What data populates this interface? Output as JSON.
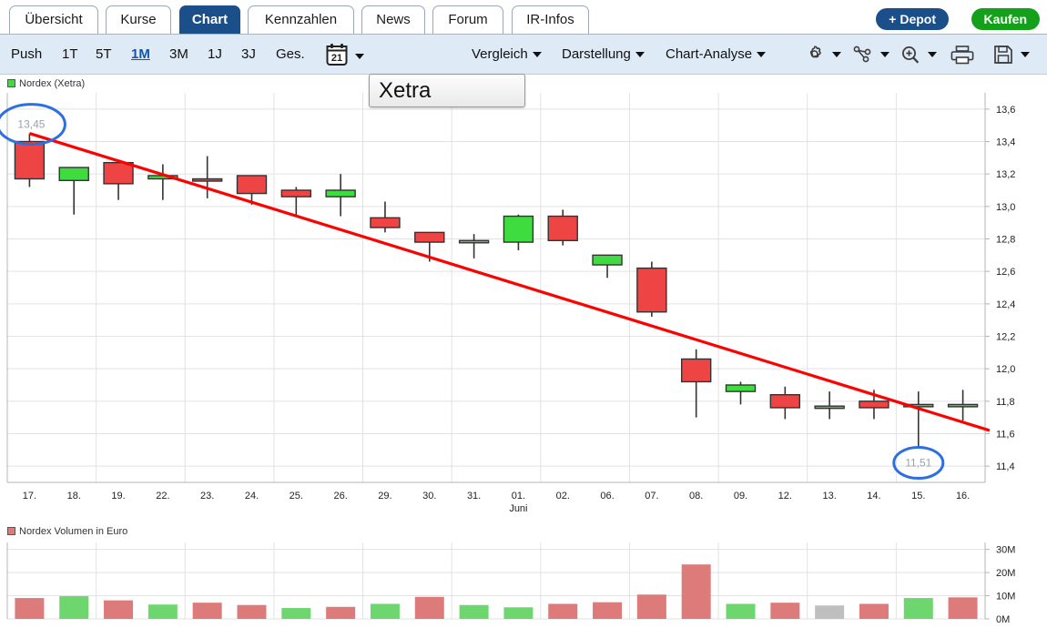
{
  "tabs": [
    {
      "label": "Übersicht",
      "active": false
    },
    {
      "label": "Kurse",
      "active": false
    },
    {
      "label": "Chart",
      "active": true
    },
    {
      "label": "Kennzahlen",
      "active": false
    },
    {
      "label": "News",
      "active": false
    },
    {
      "label": "Forum",
      "active": false
    },
    {
      "label": "IR-Infos",
      "active": false
    }
  ],
  "actions": {
    "depot": "+ Depot",
    "buy": "Kaufen"
  },
  "toolbar": {
    "ranges": [
      {
        "label": "Push",
        "selected": false
      },
      {
        "label": "1T",
        "selected": false
      },
      {
        "label": "5T",
        "selected": false
      },
      {
        "label": "1M",
        "selected": true
      },
      {
        "label": "3M",
        "selected": false
      },
      {
        "label": "1J",
        "selected": false
      },
      {
        "label": "3J",
        "selected": false
      },
      {
        "label": "Ges.",
        "selected": false
      }
    ],
    "calendar_icon": "calendar-21-icon",
    "menus": [
      {
        "label": "Vergleich"
      },
      {
        "label": "Darstellung"
      },
      {
        "label": "Chart-Analyse"
      }
    ],
    "icons": [
      {
        "name": "gear-icon",
        "caret": true
      },
      {
        "name": "indicator-nodes-icon",
        "caret": true
      },
      {
        "name": "zoom-in-icon",
        "caret": true
      },
      {
        "name": "printer-icon",
        "caret": false
      },
      {
        "name": "save-floppy-icon",
        "caret": true
      }
    ],
    "exchange_selector": "Xetra"
  },
  "price_legend": {
    "label": "Nordex (Xetra)",
    "color": "#3fdc3f"
  },
  "volume_legend": {
    "label": "Nordex Volumen in Euro",
    "color": "#dd7b7b"
  },
  "colors": {
    "up": "#3fdc3f",
    "down": "#ef4444",
    "trendline": "#ff0000",
    "annotation": "#2d6fe0",
    "grid": "#e2e2e2",
    "volume_up": "#6ed66e",
    "volume_down": "#dd7b7b",
    "volume_flat": "#bfbfbf",
    "accent": "#1b4f8a",
    "buy": "#15a01c"
  },
  "chart_data": {
    "type": "candlestick",
    "title": "Nordex (Xetra)",
    "xlabel": "Juni",
    "ylabel": "",
    "ylim": [
      11.3,
      13.7
    ],
    "yticks": [
      "13,6",
      "13,4",
      "13,2",
      "13,0",
      "12,8",
      "12,6",
      "12,4",
      "12,2",
      "12,0",
      "11,8",
      "11,6",
      "11,4"
    ],
    "ytick_values": [
      13.6,
      13.4,
      13.2,
      13.0,
      12.8,
      12.6,
      12.4,
      12.2,
      12.0,
      11.8,
      11.6,
      11.4
    ],
    "categories": [
      "17.",
      "18.",
      "19.",
      "22.",
      "23.",
      "24.",
      "25.",
      "26.",
      "29.",
      "30.",
      "31.",
      "01.",
      "02.",
      "06.",
      "07.",
      "08.",
      "09.",
      "12.",
      "13.",
      "14.",
      "15.",
      "16."
    ],
    "month_label": "Juni",
    "month_label_index": 11,
    "grid": true,
    "ohlc": [
      {
        "date": "17.",
        "open": 13.4,
        "high": 13.45,
        "low": 13.12,
        "close": 13.17,
        "dir": "down"
      },
      {
        "date": "18.",
        "open": 13.16,
        "high": 13.24,
        "low": 12.95,
        "close": 13.24,
        "dir": "up"
      },
      {
        "date": "19.",
        "open": 13.27,
        "high": 13.27,
        "low": 13.04,
        "close": 13.14,
        "dir": "down"
      },
      {
        "date": "22.",
        "open": 13.17,
        "high": 13.26,
        "low": 13.04,
        "close": 13.19,
        "dir": "up"
      },
      {
        "date": "23.",
        "open": 13.17,
        "high": 13.31,
        "low": 13.05,
        "close": 13.17,
        "dir": "down"
      },
      {
        "date": "24.",
        "open": 13.19,
        "high": 13.19,
        "low": 13.01,
        "close": 13.08,
        "dir": "down"
      },
      {
        "date": "25.",
        "open": 13.1,
        "high": 13.12,
        "low": 12.94,
        "close": 13.06,
        "dir": "down"
      },
      {
        "date": "26.",
        "open": 13.06,
        "high": 13.2,
        "low": 12.94,
        "close": 13.1,
        "dir": "up"
      },
      {
        "date": "29.",
        "open": 12.93,
        "high": 13.03,
        "low": 12.84,
        "close": 12.87,
        "dir": "down"
      },
      {
        "date": "30.",
        "open": 12.84,
        "high": 12.84,
        "low": 12.66,
        "close": 12.78,
        "dir": "down"
      },
      {
        "date": "31.",
        "open": 12.79,
        "high": 12.83,
        "low": 12.68,
        "close": 12.79,
        "dir": "up"
      },
      {
        "date": "01.",
        "open": 12.78,
        "high": 12.95,
        "low": 12.73,
        "close": 12.94,
        "dir": "up"
      },
      {
        "date": "02.",
        "open": 12.94,
        "high": 12.98,
        "low": 12.76,
        "close": 12.79,
        "dir": "down"
      },
      {
        "date": "06.",
        "open": 12.64,
        "high": 12.7,
        "low": 12.56,
        "close": 12.7,
        "dir": "up"
      },
      {
        "date": "07.",
        "open": 12.62,
        "high": 12.66,
        "low": 12.32,
        "close": 12.35,
        "dir": "down"
      },
      {
        "date": "08.",
        "open": 12.06,
        "high": 12.12,
        "low": 11.7,
        "close": 11.92,
        "dir": "down"
      },
      {
        "date": "09.",
        "open": 11.86,
        "high": 11.92,
        "low": 11.78,
        "close": 11.9,
        "dir": "up"
      },
      {
        "date": "12.",
        "open": 11.84,
        "high": 11.89,
        "low": 11.69,
        "close": 11.76,
        "dir": "down"
      },
      {
        "date": "13.",
        "open": 11.77,
        "high": 11.86,
        "low": 11.69,
        "close": 11.77,
        "dir": "flat"
      },
      {
        "date": "14.",
        "open": 11.8,
        "high": 11.87,
        "low": 11.69,
        "close": 11.76,
        "dir": "down"
      },
      {
        "date": "15.",
        "open": 11.77,
        "high": 11.86,
        "low": 11.51,
        "close": 11.78,
        "dir": "up"
      },
      {
        "date": "16.",
        "open": 11.78,
        "high": 11.87,
        "low": 11.68,
        "close": 11.78,
        "dir": "flat"
      }
    ],
    "annotations": [
      {
        "label": "13,45",
        "type": "ellipse",
        "x_index": 0,
        "value": 13.45
      },
      {
        "label": "11,51",
        "type": "ellipse",
        "x_index": 20,
        "value": 11.51
      }
    ],
    "trendline": {
      "from": {
        "x_index": 0,
        "value": 13.45
      },
      "to": {
        "x_index": 21.6,
        "value": 11.62
      },
      "color": "#ff0000"
    }
  },
  "volume_chart": {
    "type": "bar",
    "title": "Nordex Volumen in Euro",
    "ylabel": "",
    "yticks": [
      "30M",
      "20M",
      "10M",
      "0M"
    ],
    "ytick_values": [
      30,
      20,
      10,
      0
    ],
    "ylim": [
      0,
      30
    ],
    "categories": [
      "17.",
      "18.",
      "19.",
      "22.",
      "23.",
      "24.",
      "25.",
      "26.",
      "29.",
      "30.",
      "31.",
      "01.",
      "02.",
      "06.",
      "07.",
      "08.",
      "09.",
      "12.",
      "13.",
      "14.",
      "15.",
      "16."
    ],
    "values": [
      9.0,
      9.8,
      8.0,
      6.2,
      7.0,
      6.0,
      4.7,
      5.2,
      6.5,
      9.5,
      6.0,
      5.0,
      6.5,
      7.2,
      10.5,
      23.5,
      6.5,
      7.0,
      5.8,
      6.5,
      9.0,
      9.3
    ],
    "bar_colors": [
      "down",
      "up",
      "down",
      "up",
      "down",
      "down",
      "up",
      "down",
      "up",
      "down",
      "up",
      "up",
      "down",
      "down",
      "down",
      "down",
      "up",
      "down",
      "flat",
      "down",
      "up",
      "down"
    ]
  }
}
